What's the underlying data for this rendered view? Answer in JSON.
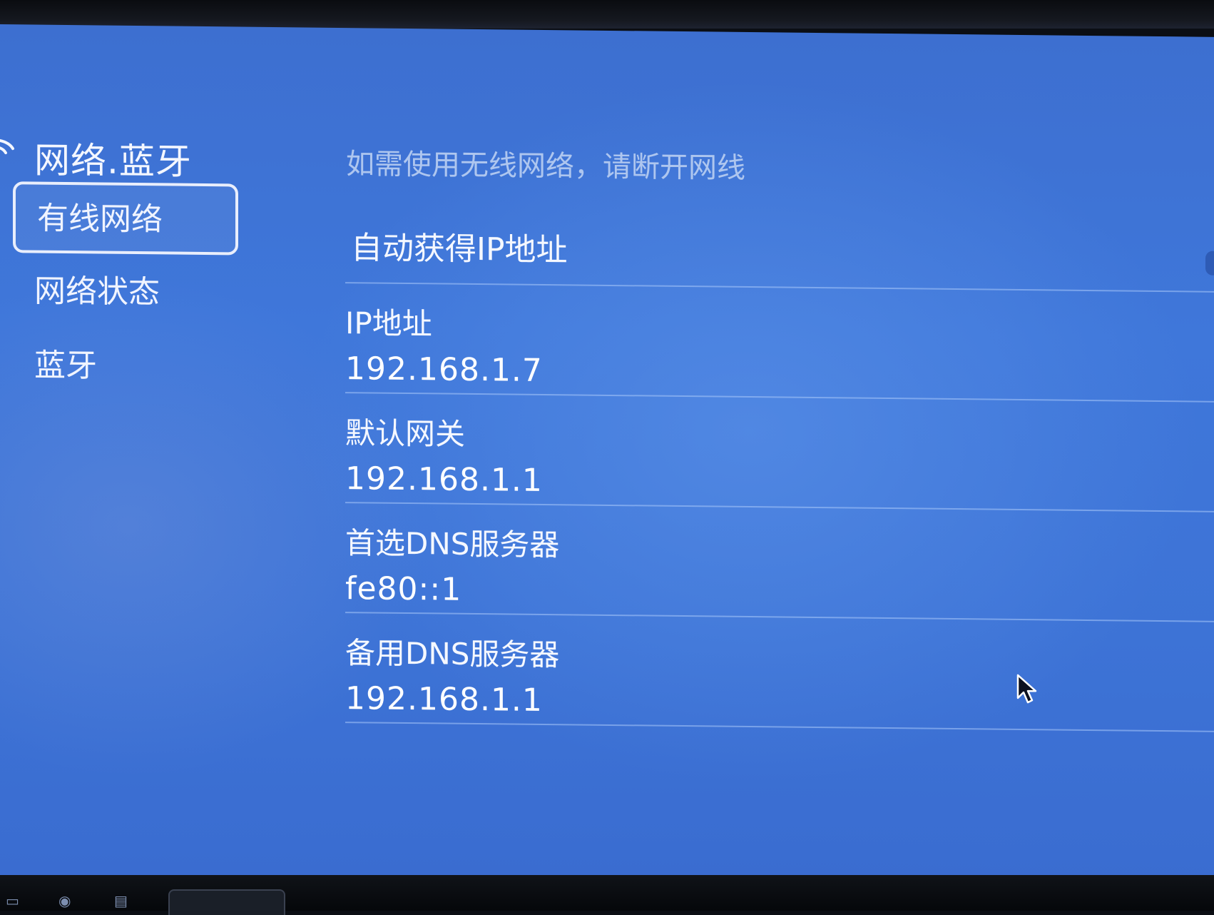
{
  "sidebar": {
    "title": "网络.蓝牙",
    "items": [
      {
        "label": "有线网络",
        "selected": true
      },
      {
        "label": "网络状态",
        "selected": false
      },
      {
        "label": "蓝牙",
        "selected": false
      }
    ]
  },
  "main": {
    "hint": "如需使用无线网络，请断开网线",
    "auto_ip": {
      "label": "自动获得IP地址"
    },
    "fields": [
      {
        "label": "IP地址",
        "value": "192.168.1.7"
      },
      {
        "label": "默认网关",
        "value": "192.168.1.1"
      },
      {
        "label": "首选DNS服务器",
        "value": "fe80::1"
      },
      {
        "label": "备用DNS服务器",
        "value": "192.168.1.1"
      }
    ]
  },
  "colors": {
    "background": "#3f77da",
    "text": "#ffffff",
    "hint_text": "#aec6ef",
    "selection_border": "#e9eefc"
  },
  "icons": [
    "wifi-icon",
    "mouse-cursor-icon"
  ]
}
